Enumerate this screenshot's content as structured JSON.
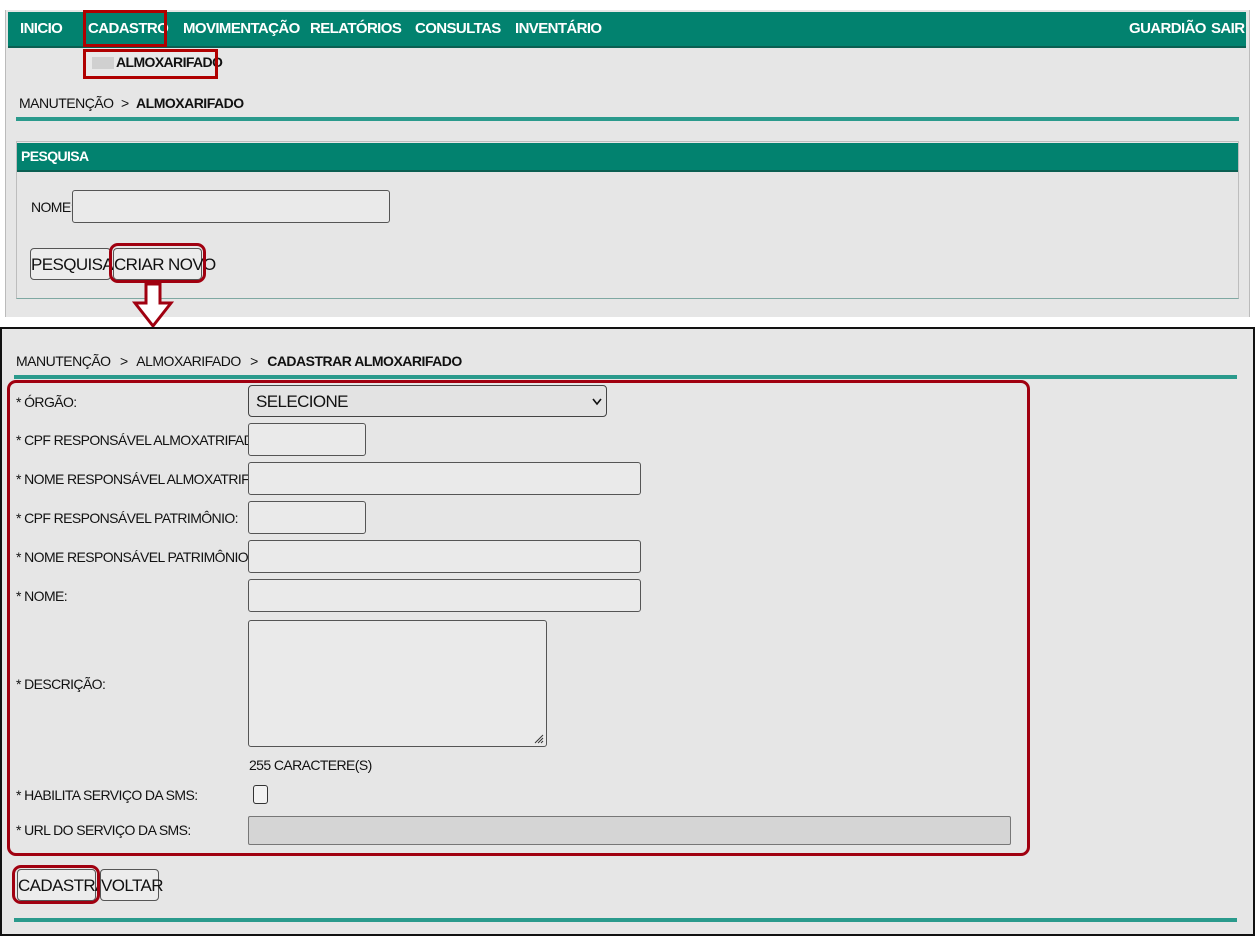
{
  "nav": {
    "items": [
      "INICIO",
      "CADASTRO",
      "MOVIMENTAÇÃO",
      "RELATÓRIOS",
      "CONSULTAS",
      "INVENTÁRIO"
    ],
    "right": [
      "GUARDIÃO",
      "SAIR"
    ],
    "submenu_item": "ALMOXARIFADO"
  },
  "screen1": {
    "breadcrumb": {
      "root": "MANUTENÇÃO",
      "separator": ">",
      "current": "ALMOXARIFADO"
    },
    "panel_title": "PESQUISA",
    "name_label": "NOME:",
    "search_button": "PESQUISAR",
    "create_button": "CRIAR NOVO"
  },
  "screen2": {
    "breadcrumb": {
      "root": "MANUTENÇÃO",
      "separator": ">",
      "middle": "ALMOXARIFADO",
      "current": "CADASTRAR ALMOXARIFADO"
    },
    "fields": {
      "orgao": {
        "label": "* ÓRGÃO:",
        "selected": "SELECIONE"
      },
      "cpf_almox": {
        "label": "* CPF RESPONSÁVEL ALMOXATRIFADO:"
      },
      "nome_almox": {
        "label": "* NOME RESPONSÁVEL ALMOXATRIFADO:"
      },
      "cpf_patrimonio": {
        "label": "* CPF RESPONSÁVEL PATRIMÔNIO:"
      },
      "nome_patrimonio": {
        "label": "* NOME RESPONSÁVEL PATRIMÔNIO:"
      },
      "nome": {
        "label": "* NOME:"
      },
      "descricao": {
        "label": "* DESCRIÇÃO:",
        "counter": "255 CARACTERE(S)"
      },
      "sms": {
        "label": "* HABILITA SERVIÇO DA SMS:"
      },
      "url_sms": {
        "label": "* URL DO SERVIÇO DA SMS:"
      }
    },
    "register_button": "CADASTRAR",
    "back_button": "VOLTAR"
  },
  "colors": {
    "nav_teal": "#02826f",
    "highlight_red": "#b00000",
    "panel_bg": "#e6e6e6"
  },
  "icons": {
    "select_arrow": "chevron-down-icon",
    "flow_arrow": "arrow-down-icon",
    "resize_grip": "resize-grip-icon"
  }
}
